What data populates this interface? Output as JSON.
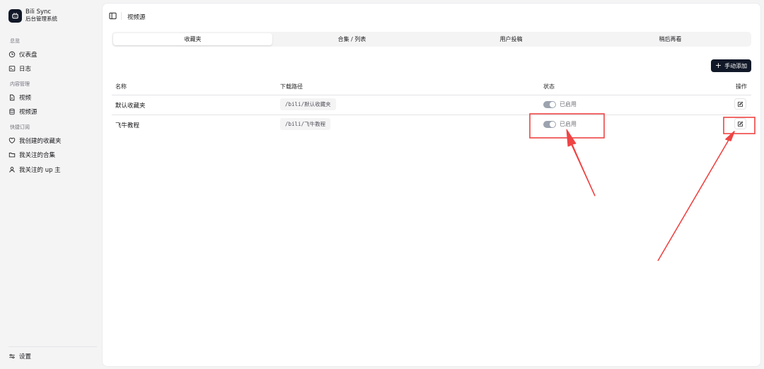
{
  "brand": {
    "name": "Bili Sync",
    "subtitle": "后台管理系统"
  },
  "sidebar": {
    "groups": [
      {
        "label": "总览",
        "items": [
          {
            "label": "仪表盘",
            "icon": "clock-icon"
          },
          {
            "label": "日志",
            "icon": "terminal-icon"
          }
        ]
      },
      {
        "label": "内容管理",
        "items": [
          {
            "label": "视频",
            "icon": "file-video-icon"
          },
          {
            "label": "视频源",
            "icon": "database-icon"
          }
        ]
      },
      {
        "label": "快捷订阅",
        "items": [
          {
            "label": "我创建的收藏夹",
            "icon": "heart-icon"
          },
          {
            "label": "我关注的合集",
            "icon": "folder-icon"
          },
          {
            "label": "我关注的 up 主",
            "icon": "user-icon"
          }
        ]
      }
    ],
    "settings_label": "设置"
  },
  "topbar": {
    "title": "视频源"
  },
  "tabs": [
    {
      "label": "收藏夹",
      "active": true
    },
    {
      "label": "合集 / 列表",
      "active": false
    },
    {
      "label": "用户投稿",
      "active": false
    },
    {
      "label": "稍后再看",
      "active": false
    }
  ],
  "add_button": {
    "label": "手动添加"
  },
  "table": {
    "columns": {
      "name": "名称",
      "path": "下载路径",
      "status": "状态",
      "actions": "操作"
    },
    "rows": [
      {
        "name": "默认收藏夹",
        "path": "/bili/默认收藏夹",
        "status": "已启用",
        "enabled": true
      },
      {
        "name": "飞牛教程",
        "path": "/bili/飞牛教程",
        "status": "已启用",
        "enabled": true
      }
    ]
  },
  "annotation": {
    "color": "#ef4444"
  }
}
